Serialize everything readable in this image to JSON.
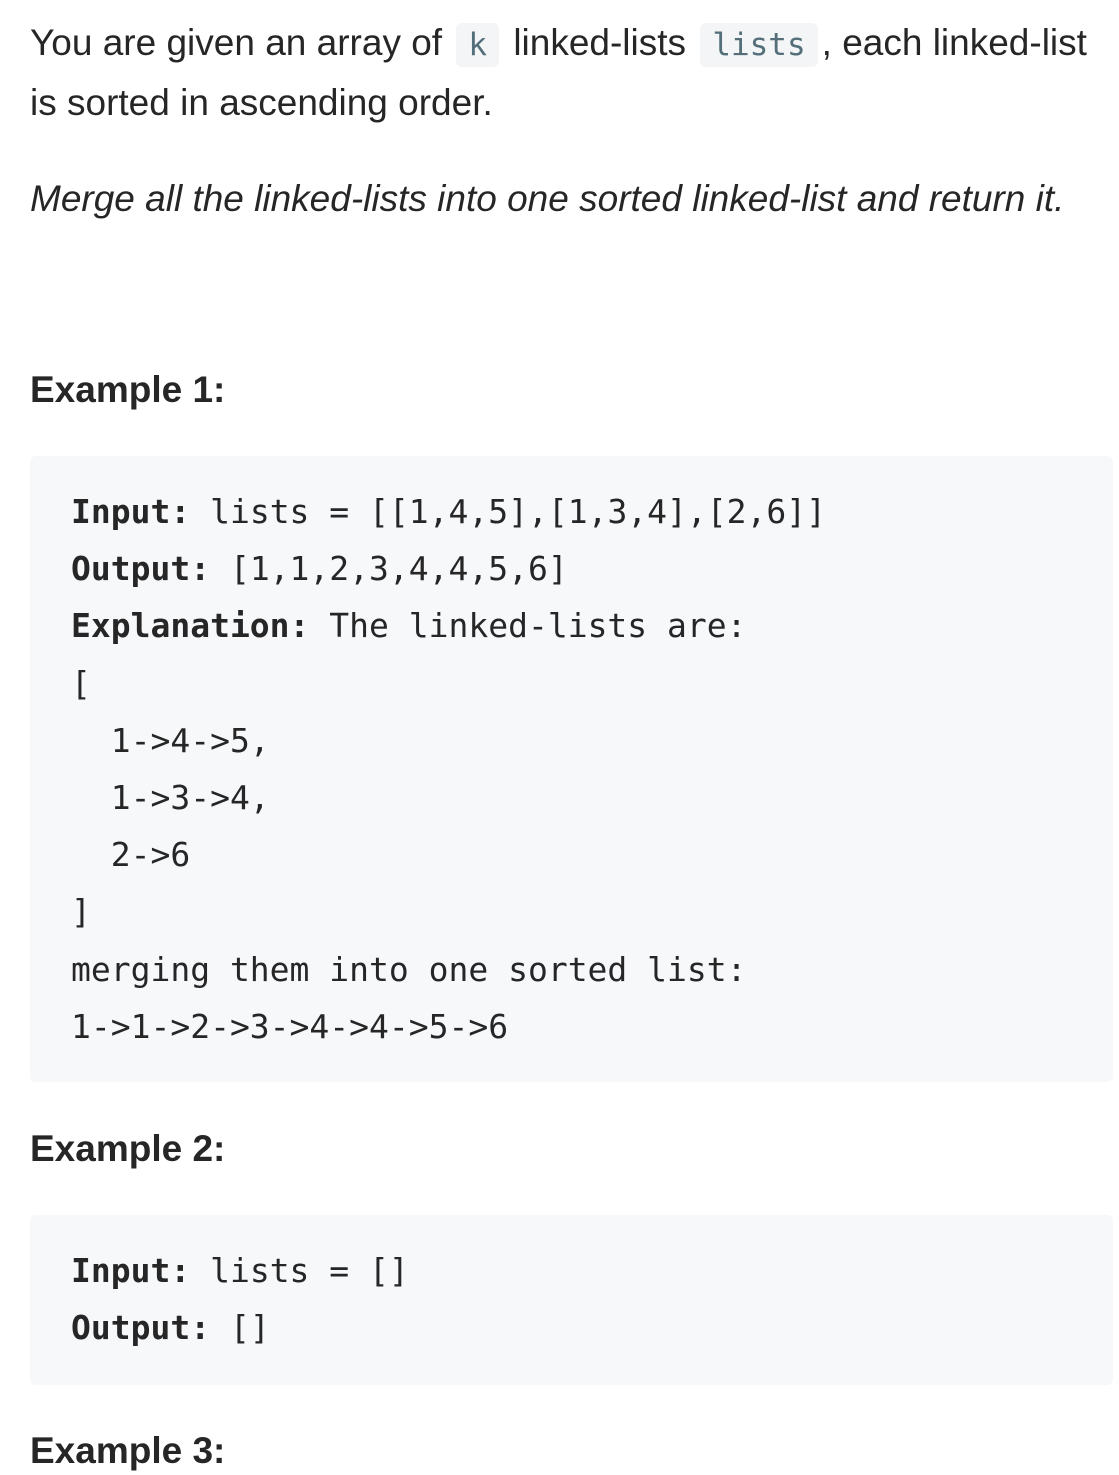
{
  "intro": {
    "before_k": "You are given an array of",
    "k": "k",
    "mid": "linked-lists",
    "lists": "lists",
    "after_lists": ", each linked-list is sorted in ascending order.",
    "task": "Merge all the linked-lists into one sorted linked-list and return it."
  },
  "examples": [
    {
      "title": "Example 1:",
      "input_label": "Input:",
      "input_value": " lists = [[1,4,5],[1,3,4],[2,6]]",
      "output_label": "Output:",
      "output_value": " [1,1,2,3,4,4,5,6]",
      "explanation_label": "Explanation:",
      "explanation_lines": [
        " The linked-lists are:",
        "[",
        "  1->4->5,",
        "  1->3->4,",
        "  2->6",
        "]",
        "merging them into one sorted list:",
        "1->1->2->3->4->4->5->6"
      ]
    },
    {
      "title": "Example 2:",
      "input_label": "Input:",
      "input_value": " lists = []",
      "output_label": "Output:",
      "output_value": " []"
    },
    {
      "title": "Example 3:"
    }
  ]
}
